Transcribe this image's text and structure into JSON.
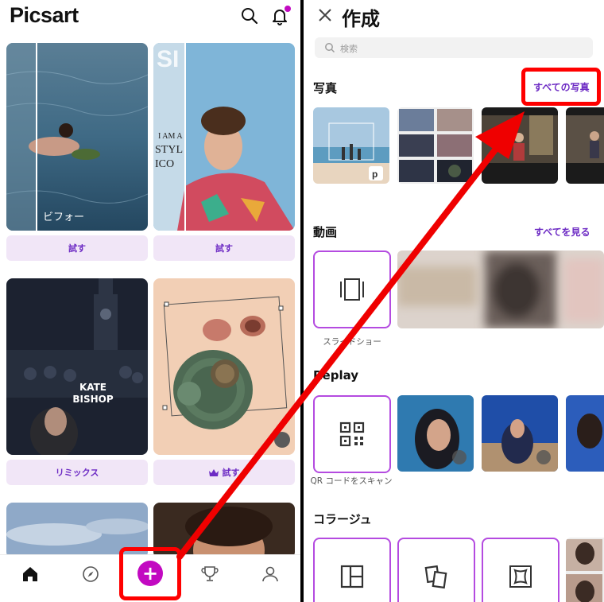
{
  "left": {
    "logo": "Picsart",
    "cards": {
      "before_label": "ビフォー",
      "kate_title": "KATE\nBISHOP"
    },
    "buttons": {
      "try1": "試す",
      "try2": "試す",
      "remix": "リミックス",
      "try_premium": "試す"
    },
    "nav": [
      "home-icon",
      "explore-icon",
      "create-plus-icon",
      "challenges-icon",
      "profile-icon"
    ]
  },
  "right": {
    "title": "作成",
    "search_placeholder": "検索",
    "photos": {
      "title": "写真",
      "link": "すべての写真"
    },
    "videos": {
      "title": "動画",
      "link": "すべてを見る",
      "slideshow_label": "スライドショー"
    },
    "replay": {
      "title": "Replay",
      "qr_label": "QR コードをスキャン"
    },
    "collage": {
      "title": "コラージュ"
    }
  },
  "colors": {
    "accent": "#c209c1",
    "link": "#6d2bc4",
    "pill_bg": "#f1e6f7",
    "highlight": "#ff0000"
  }
}
